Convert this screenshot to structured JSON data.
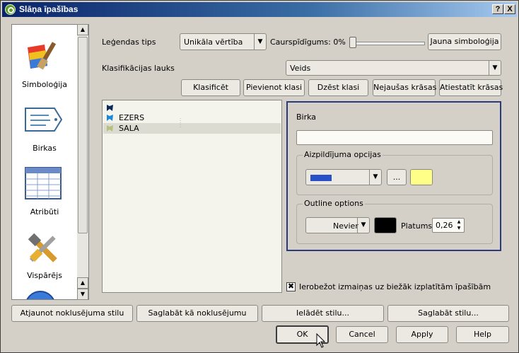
{
  "window": {
    "title": "Slāņa īpašības",
    "help_label": "?",
    "close_label": "X"
  },
  "sidebar": {
    "items": [
      {
        "label": "Simboloģija",
        "icon": "paintbrush-icon"
      },
      {
        "label": "Birkas",
        "icon": "label-tag-icon"
      },
      {
        "label": "Atribūti",
        "icon": "table-icon"
      },
      {
        "label": "Vispārējs",
        "icon": "tools-icon"
      }
    ],
    "scroll_up": "▲",
    "scroll_down": "▼"
  },
  "symbology": {
    "legend_type_label": "Leģendas tips",
    "legend_type_value": "Unikāla vērtība",
    "transparency_label": "Caurspīdīgums: 0%",
    "new_symbology_label": "Jauna simboloģija",
    "classification_field_label": "Klasifikācijas lauks",
    "classification_field_value": "Veids",
    "buttons": {
      "classify": "Klasificēt",
      "add_class": "Pievienot klasi",
      "delete_class": "Dzēst klasi",
      "random_colors": "Nejaušas krāsas",
      "reset_colors": "Atiestatīt krāsas"
    },
    "classes": [
      {
        "label": "",
        "color": "#0a2a5a"
      },
      {
        "label": "EZERS",
        "color": "#1a8ad8"
      },
      {
        "label": "SALA",
        "color": "#b8c080"
      }
    ]
  },
  "properties_panel": {
    "label_title": "Birka",
    "label_value": "",
    "fill_options_title": "Aizpildījuma opcijas",
    "fill_style_color": "#2a50c8",
    "fill_more_label": "...",
    "fill_color": "#ffff88",
    "outline_options_title": "Outline options",
    "outline_style_value": "Nevier",
    "outline_color": "#000000",
    "width_label": "Platums",
    "width_value": "0,26"
  },
  "restrict_checkbox_label": "Ierobežot izmaiņas uz biežāk izplatītām īpašībām",
  "bottom_buttons": {
    "restore_default": "Atjaunot noklusējuma stilu",
    "save_as_default": "Saglabāt kā noklusējumu",
    "load_style": "Ielādēt stilu...",
    "save_style": "Saglabāt stilu..."
  },
  "dialog_buttons": {
    "ok": "OK",
    "cancel": "Cancel",
    "apply": "Apply",
    "help": "Help"
  }
}
